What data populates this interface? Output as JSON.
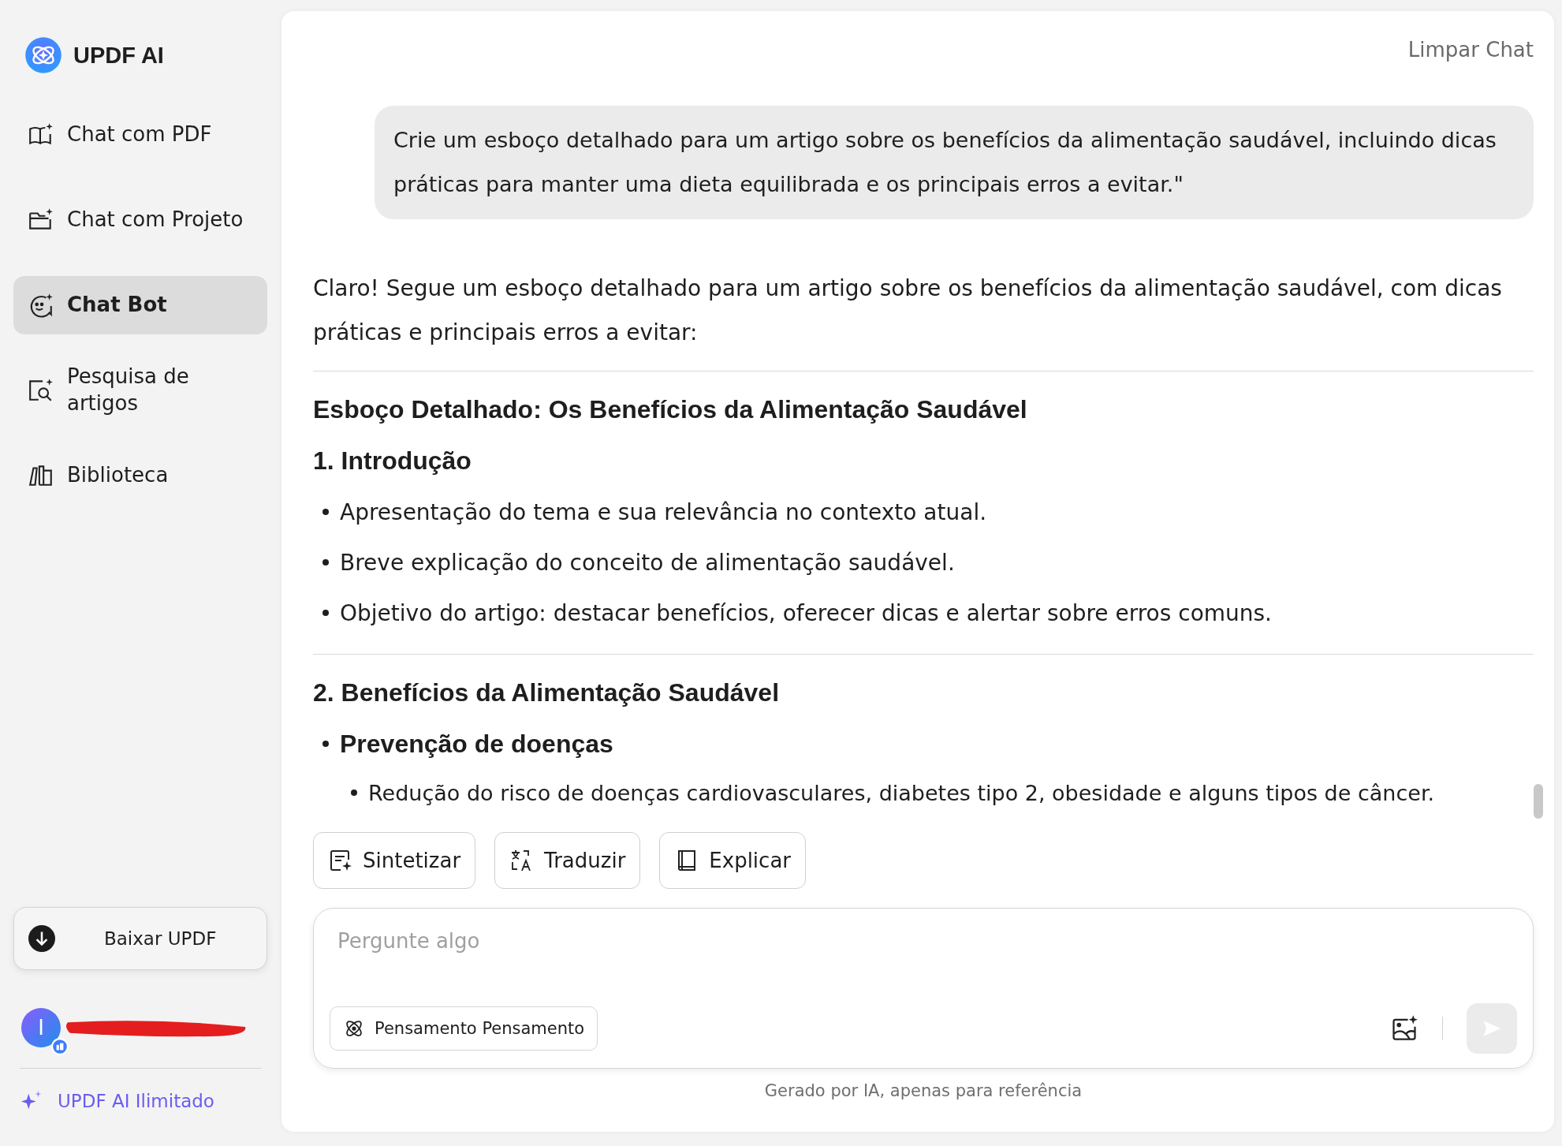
{
  "sidebar": {
    "logo": "UPDF AI",
    "items": [
      {
        "label": "Chat com PDF",
        "selected": false
      },
      {
        "label": "Chat com Projeto",
        "selected": false
      },
      {
        "label": "Chat Bot",
        "selected": true
      },
      {
        "label": "Pesquisa de artigos",
        "selected": false
      },
      {
        "label": "Biblioteca",
        "selected": false
      }
    ],
    "download_button": "Baixar UPDF",
    "user": {
      "avatar_initial": "I"
    },
    "upgrade_link": "UPDF AI Ilimitado"
  },
  "chat": {
    "clear_button": "Limpar Chat",
    "user_message": "Crie um esboço detalhado para um artigo sobre os benefícios da alimentação saudável, incluindo dicas práticas para manter uma dieta equilibrada e os principais erros a evitar.\"",
    "answer": [
      {
        "kind": "paragraph",
        "text": "Claro! Segue um esboço detalhado para um artigo sobre os benefícios da alimentação saudável, com dicas práticas e principais erros a evitar:"
      },
      {
        "kind": "divider"
      },
      {
        "kind": "title",
        "text": "Esboço Detalhado: Os Benefícios da Alimentação Saudável"
      },
      {
        "kind": "heading",
        "text": "1. Introdução"
      },
      {
        "kind": "bullet",
        "text": "Apresentação do tema e sua relevância no contexto atual."
      },
      {
        "kind": "bullet",
        "text": "Breve explicação do conceito de alimentação saudável."
      },
      {
        "kind": "bullet",
        "text": "Objetivo do artigo: destacar benefícios, oferecer dicas e alertar sobre erros comuns."
      },
      {
        "kind": "divider"
      },
      {
        "kind": "heading",
        "text": "2. Benefícios da Alimentação Saudável"
      },
      {
        "kind": "bold_bullet",
        "text": "Prevenção de doenças"
      },
      {
        "kind": "sub_bullet",
        "text": "Redução do risco de doenças cardiovasculares, diabetes tipo 2, obesidade e alguns tipos de câncer."
      }
    ]
  },
  "actions": [
    "Sintetizar",
    "Traduzir",
    "Explicar"
  ],
  "composer": {
    "placeholder": "Pergunte algo",
    "mode_button": "Pensamento Pensamento"
  },
  "footer": "Gerado por IA, apenas para referência"
}
